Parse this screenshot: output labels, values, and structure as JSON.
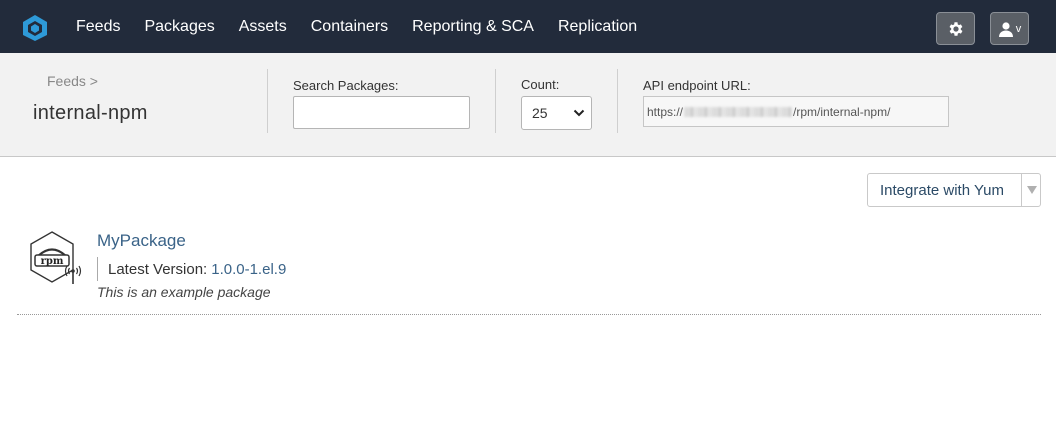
{
  "nav": {
    "items": [
      {
        "label": "Feeds"
      },
      {
        "label": "Packages"
      },
      {
        "label": "Assets"
      },
      {
        "label": "Containers"
      },
      {
        "label": "Reporting & SCA"
      },
      {
        "label": "Replication"
      }
    ],
    "icons": {
      "logo": "proget-hexagon-logo",
      "settings": "gear-icon",
      "user": "user-icon"
    },
    "user_menu_caret": "v"
  },
  "header": {
    "breadcrumb": "Feeds >",
    "feed_name": "internal-npm",
    "search": {
      "label": "Search Packages:",
      "value": "",
      "placeholder": ""
    },
    "count": {
      "label": "Count:",
      "value": "25"
    },
    "api": {
      "label": "API endpoint URL:",
      "prefix": "https://",
      "suffix": "/rpm/internal-npm/"
    }
  },
  "actions": {
    "integrate_label": "Integrate with Yum"
  },
  "packages": [
    {
      "icon": "rpm-icon",
      "icon_text": "rpm",
      "name": "MyPackage",
      "version_label": "Latest Version:",
      "version": "1.0.0-1.el.9",
      "description": "This is an example package"
    }
  ],
  "colors": {
    "nav_bg": "#222b3b",
    "logo_blue": "#2e9ad8",
    "link": "#3a6388",
    "header_bg": "#f2f2f2"
  }
}
